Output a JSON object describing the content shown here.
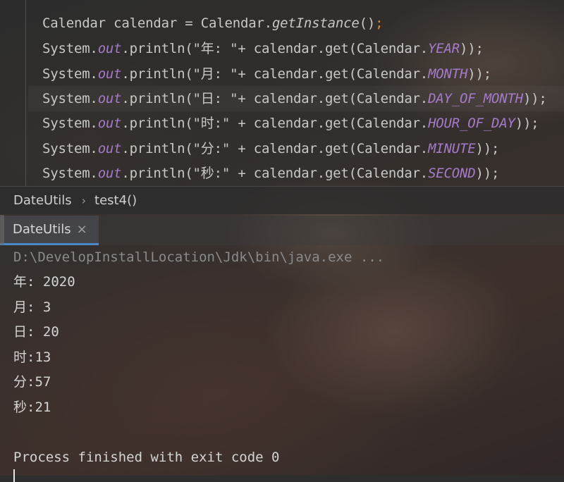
{
  "editor": {
    "line1": {
      "a": "Calendar calendar = Calendar.",
      "method": "getInstance",
      "b": "()",
      "semi": ";"
    },
    "lines": [
      {
        "pre": "System.",
        "out": "out",
        "mid": ".println(\"年: \"+ calendar.get(Calendar.",
        "field": "YEAR",
        "end": "));"
      },
      {
        "pre": "System.",
        "out": "out",
        "mid": ".println(\"月: \"+ calendar.get(Calendar.",
        "field": "MONTH",
        "end": "));"
      },
      {
        "pre": "System.",
        "out": "out",
        "mid": ".println(\"日: \"+ calendar.get(Calendar.",
        "field": "DAY_OF_MONTH",
        "end": "));"
      },
      {
        "pre": "System.",
        "out": "out",
        "mid": ".println(\"时:\" + calendar.get(Calendar.",
        "field": "HOUR_OF_DAY",
        "end": "));"
      },
      {
        "pre": "System.",
        "out": "out",
        "mid": ".println(\"分:\" + calendar.get(Calendar.",
        "field": "MINUTE",
        "end": "));"
      },
      {
        "pre": "System.",
        "out": "out",
        "mid": ".println(\"秒:\" + calendar.get(Calendar.",
        "field": "SECOND",
        "end": "));"
      }
    ]
  },
  "breadcrumb": {
    "class_name": "DateUtils",
    "separator": "›",
    "method": "test4()"
  },
  "run_panel": {
    "tab_label": "DateUtils",
    "close_glyph": "×"
  },
  "console": {
    "command": "D:\\DevelopInstallLocation\\Jdk\\bin\\java.exe ...",
    "output": [
      "年: 2020",
      "月: 3",
      "日: 20",
      "时:13",
      "分:57",
      "秒:21"
    ],
    "exit_message": "Process finished with exit code 0"
  }
}
